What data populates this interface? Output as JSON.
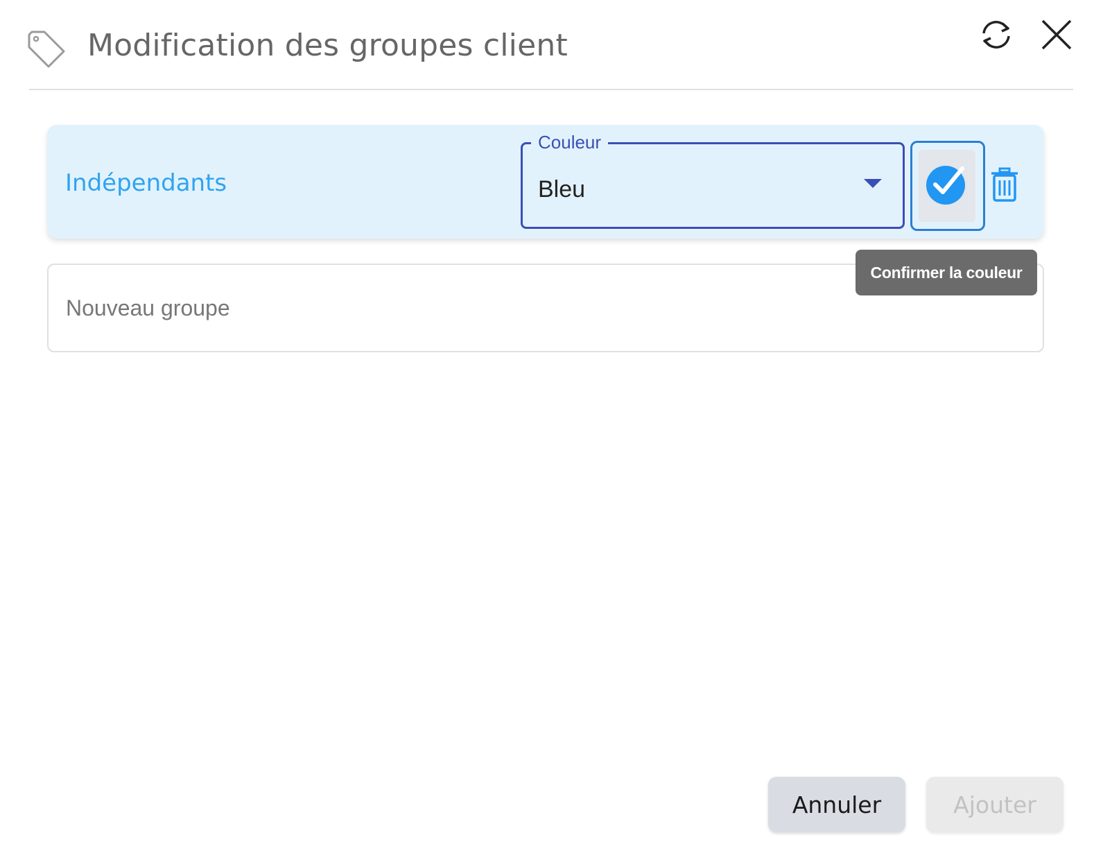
{
  "header": {
    "title": "Modification des groupes client",
    "icon": "tag-icon",
    "actions": [
      {
        "icon": "refresh-icon"
      },
      {
        "icon": "close-icon"
      }
    ]
  },
  "groups": [
    {
      "name": "Indépendants",
      "color_select": {
        "label": "Couleur",
        "value": "Bleu"
      },
      "confirm_icon": "check-circle-icon",
      "delete_icon": "trash-icon"
    }
  ],
  "new_group": {
    "placeholder": "Nouveau groupe"
  },
  "tooltip": {
    "text": "Confirmer la couleur"
  },
  "footer": {
    "cancel_label": "Annuler",
    "add_label": "Ajouter"
  },
  "colors": {
    "accent_blue": "#2fa4f0",
    "select_border": "#3a4fb5",
    "row_background": "#e2f2fd",
    "tooltip_background": "#6b6b6b"
  }
}
